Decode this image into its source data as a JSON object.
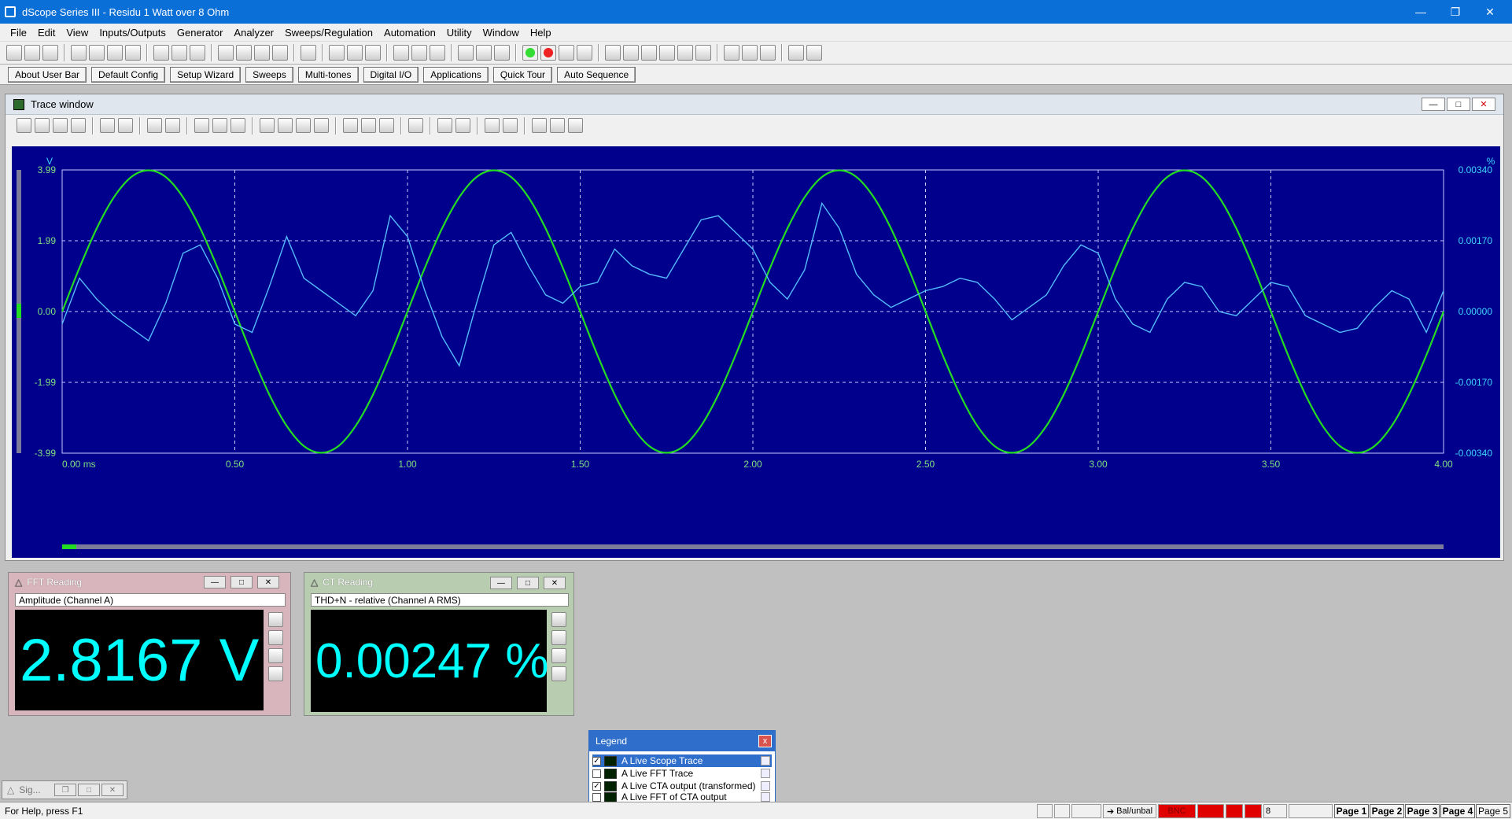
{
  "window": {
    "title": "dScope Series III - Residu 1 Watt over 8 Ohm"
  },
  "menu": [
    "File",
    "Edit",
    "View",
    "Inputs/Outputs",
    "Generator",
    "Analyzer",
    "Sweeps/Regulation",
    "Automation",
    "Utility",
    "Window",
    "Help"
  ],
  "user_bar": [
    "About User Bar",
    "Default Config",
    "Setup Wizard",
    "Sweeps",
    "Multi-tones",
    "Digital I/O",
    "Applications",
    "Quick Tour",
    "Auto Sequence"
  ],
  "trace_window": {
    "title": "Trace window",
    "left_unit": "V",
    "right_unit": "%",
    "y_ticks_left": [
      "3.99",
      "1.99",
      "0.00",
      "-1.99",
      "-3.99"
    ],
    "y_ticks_right": [
      "0.00340",
      "0.00170",
      "0.00000",
      "-0.00170",
      "-0.00340"
    ],
    "x_ticks": [
      "0.00 ms",
      "0.50",
      "1.00",
      "1.50",
      "2.00",
      "2.50",
      "3.00",
      "3.50",
      "4.00"
    ]
  },
  "chart_data": {
    "type": "line",
    "xlim": [
      0,
      4.0
    ],
    "ylim": [
      -3.99,
      3.99
    ],
    "y2lim": [
      -0.0034,
      0.0034
    ],
    "grid": true,
    "series": [
      {
        "name": "A Live Scope Trace",
        "color": "#22dd22",
        "axis": "left",
        "x": [
          0,
          0.05,
          0.1,
          0.15,
          0.2,
          0.25,
          0.3,
          0.35,
          0.4,
          0.45,
          0.5,
          0.55,
          0.6,
          0.65,
          0.7,
          0.75,
          0.8,
          0.85,
          0.9,
          0.95,
          1.0,
          1.05,
          1.1,
          1.15,
          1.2,
          1.25,
          1.3,
          1.35,
          1.4,
          1.45,
          1.5,
          1.55,
          1.6,
          1.65,
          1.7,
          1.75,
          1.8,
          1.85,
          1.9,
          1.95,
          2.0,
          2.05,
          2.1,
          2.15,
          2.2,
          2.25,
          2.3,
          2.35,
          2.4,
          2.45,
          2.5,
          2.55,
          2.6,
          2.65,
          2.7,
          2.75,
          2.8,
          2.85,
          2.9,
          2.95,
          3.0,
          3.05,
          3.1,
          3.15,
          3.2,
          3.25,
          3.3,
          3.35,
          3.4,
          3.45,
          3.5,
          3.55,
          3.6,
          3.65,
          3.7,
          3.75,
          3.8,
          3.85,
          3.9,
          3.95,
          4.0
        ],
        "y": [
          0.0,
          1.23,
          2.34,
          3.22,
          3.79,
          3.98,
          3.79,
          3.22,
          2.34,
          1.23,
          0.0,
          -1.23,
          -2.34,
          -3.22,
          -3.79,
          -3.98,
          -3.79,
          -3.22,
          -2.34,
          -1.23,
          0.0,
          1.23,
          2.34,
          3.22,
          3.79,
          3.98,
          3.79,
          3.22,
          2.34,
          1.23,
          0.0,
          -1.23,
          -2.34,
          -3.22,
          -3.79,
          -3.98,
          -3.79,
          -3.22,
          -2.34,
          -1.23,
          0.0,
          1.23,
          2.34,
          3.22,
          3.79,
          3.98,
          3.79,
          3.22,
          2.34,
          1.23,
          0.0,
          -1.23,
          -2.34,
          -3.22,
          -3.79,
          -3.98,
          -3.79,
          -3.22,
          -2.34,
          -1.23,
          0.0,
          1.23,
          2.34,
          3.22,
          3.79,
          3.98,
          3.79,
          3.22,
          2.34,
          1.23,
          0.0,
          -1.23,
          -2.34,
          -3.22,
          -3.79,
          -3.98,
          -3.79,
          -3.22,
          -2.34,
          -1.23,
          0.0
        ]
      },
      {
        "name": "A Live CTA output (transformed)",
        "color": "#55bbff",
        "axis": "right",
        "x": [
          0,
          0.05,
          0.1,
          0.15,
          0.2,
          0.25,
          0.3,
          0.35,
          0.4,
          0.45,
          0.5,
          0.55,
          0.6,
          0.65,
          0.7,
          0.75,
          0.8,
          0.85,
          0.9,
          0.95,
          1.0,
          1.05,
          1.1,
          1.15,
          1.2,
          1.25,
          1.3,
          1.35,
          1.4,
          1.45,
          1.5,
          1.55,
          1.6,
          1.65,
          1.7,
          1.75,
          1.8,
          1.85,
          1.9,
          1.95,
          2.0,
          2.05,
          2.1,
          2.15,
          2.2,
          2.25,
          2.3,
          2.35,
          2.4,
          2.45,
          2.5,
          2.55,
          2.6,
          2.65,
          2.7,
          2.75,
          2.8,
          2.85,
          2.9,
          2.95,
          3.0,
          3.05,
          3.1,
          3.15,
          3.2,
          3.25,
          3.3,
          3.35,
          3.4,
          3.45,
          3.5,
          3.55,
          3.6,
          3.65,
          3.7,
          3.75,
          3.8,
          3.85,
          3.9,
          3.95,
          4.0
        ],
        "y": [
          -0.0003,
          0.0008,
          0.0003,
          -0.0001,
          -0.0004,
          -0.0007,
          0.0002,
          0.0014,
          0.0016,
          0.0008,
          -0.0003,
          -0.0005,
          0.0006,
          0.0018,
          0.0008,
          0.0005,
          0.0002,
          -0.0001,
          0.0005,
          0.0023,
          0.0018,
          0.0005,
          -0.0006,
          -0.0013,
          0.0002,
          0.0016,
          0.0019,
          0.0011,
          0.0004,
          0.0002,
          0.0006,
          0.0007,
          0.0015,
          0.0011,
          0.0009,
          0.0008,
          0.0015,
          0.0022,
          0.0023,
          0.0019,
          0.0015,
          0.0007,
          0.0003,
          0.001,
          0.0026,
          0.002,
          0.0009,
          0.0004,
          0.0001,
          0.0003,
          0.0005,
          0.0006,
          0.0008,
          0.0007,
          0.0003,
          -0.0002,
          0.0001,
          0.0004,
          0.0011,
          0.0016,
          0.0014,
          0.0003,
          -0.0003,
          -0.0005,
          0.0003,
          0.0007,
          0.0006,
          0.0,
          -0.0001,
          0.0003,
          0.0007,
          0.0006,
          -0.0001,
          -0.0003,
          -0.0005,
          -0.0004,
          0.0001,
          0.0005,
          0.0003,
          -0.0005,
          0.0005
        ]
      }
    ]
  },
  "readings": {
    "fft": {
      "title": "FFT Reading",
      "label": "Amplitude (Channel A)",
      "value": "2.8167 V"
    },
    "ct": {
      "title": "CT Reading",
      "label": "THD+N - relative (Channel A RMS)",
      "value": "0.00247 %"
    }
  },
  "legend": {
    "title": "Legend",
    "close": "x",
    "items": [
      {
        "label": "A  Live Scope Trace",
        "checked": true,
        "selected": true
      },
      {
        "label": "A  Live FFT Trace",
        "checked": false,
        "selected": false
      },
      {
        "label": "A  Live CTA output (transformed)",
        "checked": true,
        "selected": false
      },
      {
        "label": "A  Live FFT of CTA output",
        "checked": false,
        "selected": false
      }
    ]
  },
  "minimized": {
    "label": "Sig..."
  },
  "status": {
    "help": "For Help, press F1",
    "balance": "Bal/unbal",
    "bnc": "BNC",
    "value": "8",
    "pages": [
      "Page 1",
      "Page 2",
      "Page 3",
      "Page 4",
      "Page 5"
    ]
  }
}
